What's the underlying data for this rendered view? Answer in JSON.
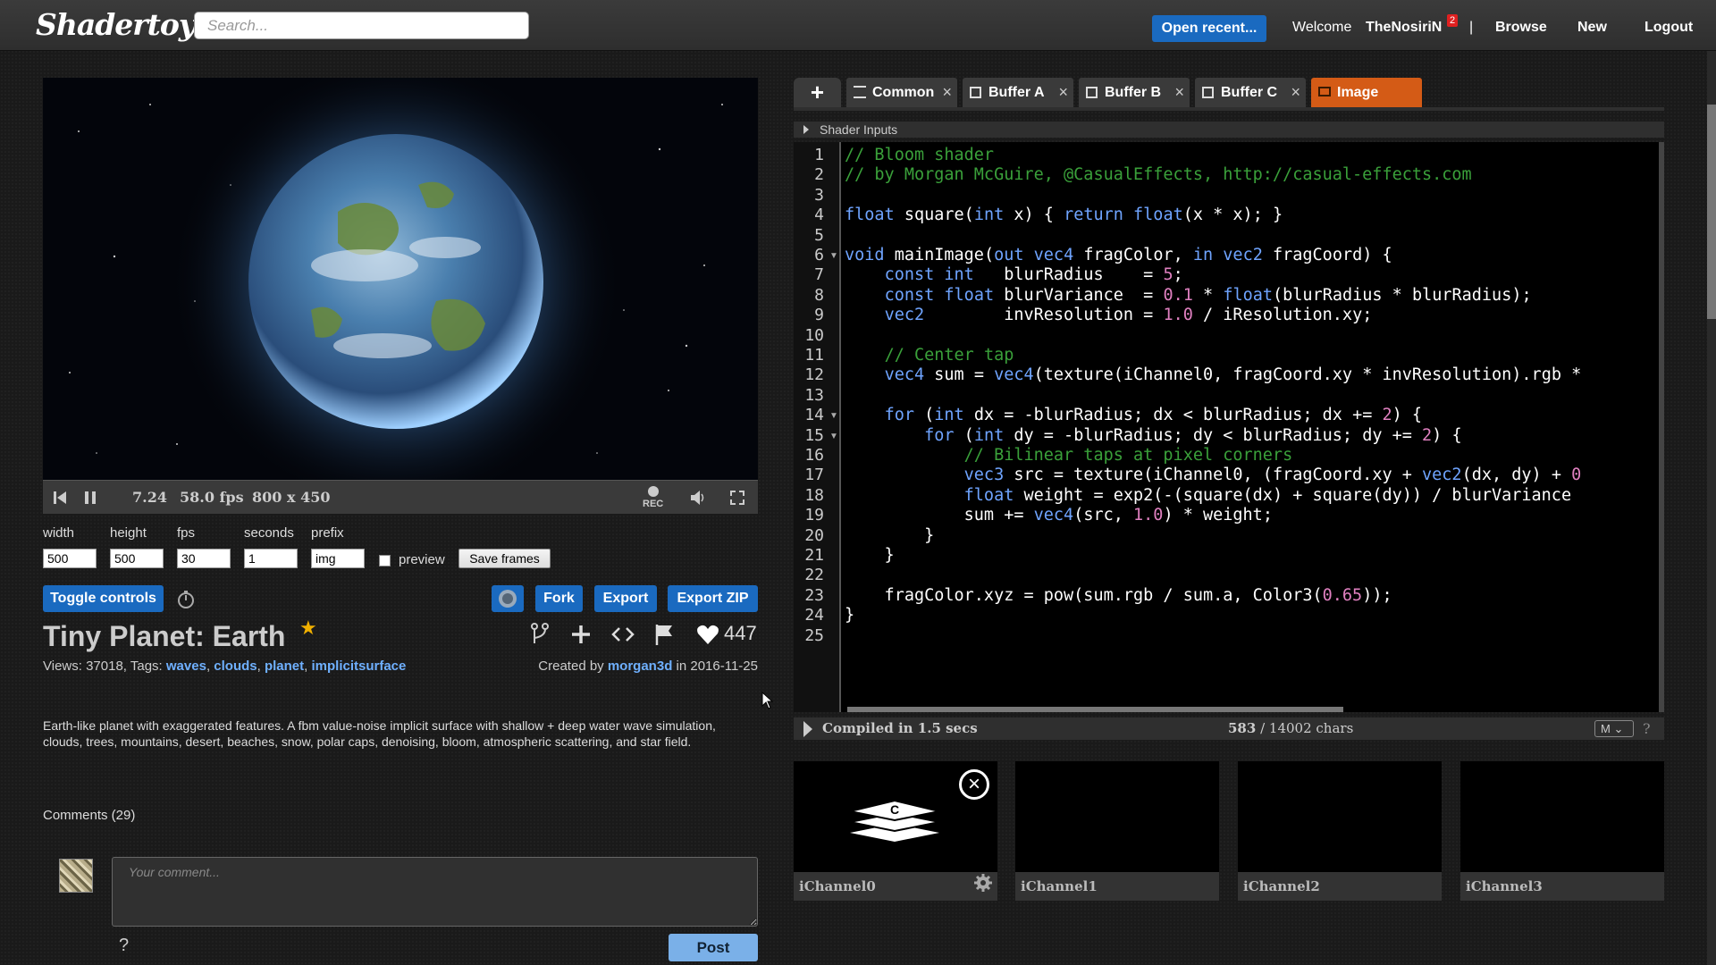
{
  "header": {
    "logo": "Shadertoy",
    "search_placeholder": "Search...",
    "open_recent": "Open recent...",
    "welcome": "Welcome",
    "username": "TheNosiriN",
    "notifications": "2",
    "separator": "|",
    "browse": "Browse",
    "new": "New",
    "logout": "Logout"
  },
  "player": {
    "time": "7.24",
    "fps": "58.0 fps",
    "resolution": "800 x 450",
    "rec_label": "REC"
  },
  "capture": {
    "labels": {
      "width": "width",
      "height": "height",
      "fps": "fps",
      "seconds": "seconds",
      "prefix": "prefix"
    },
    "values": {
      "width": "500",
      "height": "500",
      "fps": "30",
      "seconds": "1",
      "prefix": "img"
    },
    "preview_label": "preview",
    "save_frames": "Save frames"
  },
  "actions": {
    "toggle_controls": "Toggle controls",
    "fork": "Fork",
    "export": "Export",
    "export_zip": "Export ZIP"
  },
  "shader": {
    "title": "Tiny Planet: Earth",
    "views_prefix": "Views: 37018, Tags:",
    "tags": [
      "waves",
      "clouds",
      "planet",
      "implicitsurface"
    ],
    "created_prefix": "Created by",
    "author": "morgan3d",
    "created_suffix": "in 2016-11-25",
    "likes": "447",
    "description": "Earth-like planet with exaggerated features. A fbm value-noise implicit surface with shallow + deep water wave simulation, clouds, trees, mountains, desert, beaches, snow, polar caps, denoising, bloom, atmospheric scattering, and star field."
  },
  "comments": {
    "heading": "Comments (29)",
    "placeholder": "Your comment...",
    "help": "?",
    "post": "Post"
  },
  "editor": {
    "tabs": [
      "Common",
      "Buffer A",
      "Buffer B",
      "Buffer C",
      "Image"
    ],
    "active_tab": "Image",
    "shader_inputs": "Shader Inputs",
    "line_numbers": [
      "1",
      "2",
      "3",
      "4",
      "5",
      "6",
      "7",
      "8",
      "9",
      "10",
      "11",
      "12",
      "13",
      "14",
      "15",
      "16",
      "17",
      "18",
      "19",
      "20",
      "21",
      "22",
      "23",
      "24",
      "25"
    ],
    "status": {
      "compiled": "Compiled in 1.5 secs",
      "chars_used": "583",
      "chars_total": "/ 14002 chars",
      "mode": "M",
      "help": "?"
    },
    "code": [
      "// Bloom shader",
      "// by Morgan McGuire, @CasualEffects, http://casual-effects.com",
      "",
      "float square(int x) { return float(x * x); }",
      "",
      "void mainImage(out vec4 fragColor, in vec2 fragCoord) {",
      "    const int   blurRadius    = 5;",
      "    const float blurVariance  = 0.1 * float(blurRadius * blurRadius);",
      "    vec2        invResolution = 1.0 / iResolution.xy;",
      "",
      "    // Center tap",
      "    vec4 sum = vec4(texture(iChannel0, fragCoord.xy * invResolution).rgb *",
      "",
      "    for (int dx = -blurRadius; dx < blurRadius; dx += 2) {",
      "        for (int dy = -blurRadius; dy < blurRadius; dy += 2) {",
      "            // Bilinear taps at pixel corners",
      "            vec3 src = texture(iChannel0, (fragCoord.xy + vec2(dx, dy) + 0",
      "            float weight = exp2(-(square(dx) + square(dy)) / blurVariance",
      "            sum += vec4(src, 1.0) * weight;",
      "        }",
      "    }",
      "",
      "    fragColor.xyz = pow(sum.rgb / sum.a, Color3(0.65));",
      "}",
      ""
    ]
  },
  "channels": [
    "iChannel0",
    "iChannel1",
    "iChannel2",
    "iChannel3"
  ],
  "colors": {
    "accent_blue": "#1a6ac0",
    "active_tab": "#d45b16",
    "keyword": "#6fa4ff",
    "comment": "#3aa03a",
    "number": "#e080c0"
  }
}
